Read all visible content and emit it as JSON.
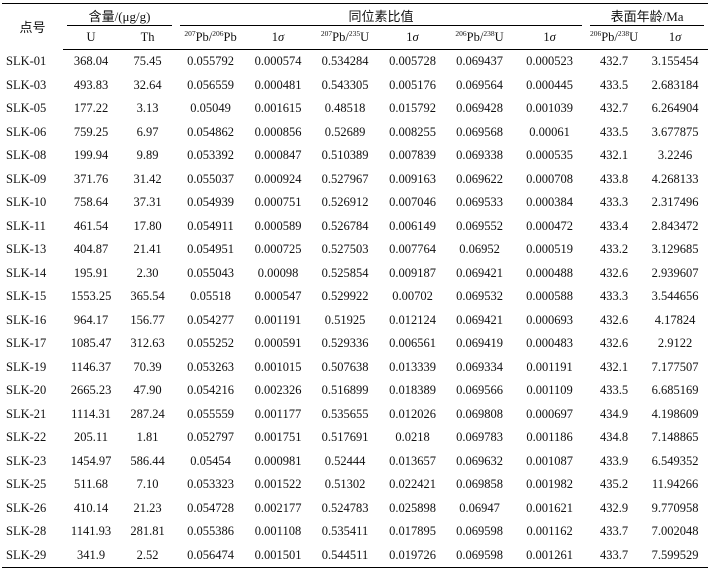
{
  "header": {
    "point_label": "点号",
    "content_label": "含量/(μg/g)",
    "ratio_label": "同位素比值",
    "age_label": "表面年龄/Ma",
    "cols": {
      "u": "U",
      "th": "Th",
      "pb207_pb206_mass_a": "207",
      "pb207_pb206_elem_a": "Pb/",
      "pb207_pb206_mass_b": "206",
      "pb207_pb206_elem_b": "Pb",
      "sigma_one_num": "1",
      "sigma_one_sym": "σ",
      "pb207_u235_mass_a": "207",
      "pb207_u235_elem_a": "Pb/",
      "pb207_u235_mass_b": "235",
      "pb207_u235_elem_b": "U",
      "pb206_u238_mass_a": "206",
      "pb206_u238_elem_a": "Pb/",
      "pb206_u238_mass_b": "238",
      "pb206_u238_elem_b": "U",
      "age_mass_a": "206",
      "age_elem_a": "Pb/",
      "age_mass_b": "238",
      "age_elem_b": "U"
    }
  },
  "rows": [
    [
      "SLK-01",
      "368.04",
      "75.45",
      "0.055792",
      "0.000574",
      "0.534284",
      "0.005728",
      "0.069437",
      "0.000523",
      "432.7",
      "3.155454"
    ],
    [
      "SLK-03",
      "493.83",
      "32.64",
      "0.056559",
      "0.000481",
      "0.543305",
      "0.005176",
      "0.069564",
      "0.000445",
      "433.5",
      "2.683184"
    ],
    [
      "SLK-05",
      "177.22",
      "3.13",
      "0.05049",
      "0.001615",
      "0.48518",
      "0.015792",
      "0.069428",
      "0.001039",
      "432.7",
      "6.264904"
    ],
    [
      "SLK-06",
      "759.25",
      "6.97",
      "0.054862",
      "0.000856",
      "0.52689",
      "0.008255",
      "0.069568",
      "0.00061",
      "433.5",
      "3.677875"
    ],
    [
      "SLK-08",
      "199.94",
      "9.89",
      "0.053392",
      "0.000847",
      "0.510389",
      "0.007839",
      "0.069338",
      "0.000535",
      "432.1",
      "3.2246"
    ],
    [
      "SLK-09",
      "371.76",
      "31.42",
      "0.055037",
      "0.000924",
      "0.527967",
      "0.009163",
      "0.069622",
      "0.000708",
      "433.8",
      "4.268133"
    ],
    [
      "SLK-10",
      "758.64",
      "37.31",
      "0.054939",
      "0.000751",
      "0.526912",
      "0.007046",
      "0.069533",
      "0.000384",
      "433.3",
      "2.317496"
    ],
    [
      "SLK-11",
      "461.54",
      "17.80",
      "0.054911",
      "0.000589",
      "0.526784",
      "0.006149",
      "0.069552",
      "0.000472",
      "433.4",
      "2.843472"
    ],
    [
      "SLK-13",
      "404.87",
      "21.41",
      "0.054951",
      "0.000725",
      "0.527503",
      "0.007764",
      "0.06952",
      "0.000519",
      "433.2",
      "3.129685"
    ],
    [
      "SLK-14",
      "195.91",
      "2.30",
      "0.055043",
      "0.00098",
      "0.525854",
      "0.009187",
      "0.069421",
      "0.000488",
      "432.6",
      "2.939607"
    ],
    [
      "SLK-15",
      "1553.25",
      "365.54",
      "0.05518",
      "0.000547",
      "0.529922",
      "0.00702",
      "0.069532",
      "0.000588",
      "433.3",
      "3.544656"
    ],
    [
      "SLK-16",
      "964.17",
      "156.77",
      "0.054277",
      "0.001191",
      "0.51925",
      "0.012124",
      "0.069421",
      "0.000693",
      "432.6",
      "4.17824"
    ],
    [
      "SLK-17",
      "1085.47",
      "312.63",
      "0.055252",
      "0.000591",
      "0.529336",
      "0.006561",
      "0.069419",
      "0.000483",
      "432.6",
      "2.9122"
    ],
    [
      "SLK-19",
      "1146.37",
      "70.39",
      "0.053263",
      "0.001015",
      "0.507638",
      "0.013339",
      "0.069334",
      "0.001191",
      "432.1",
      "7.177507"
    ],
    [
      "SLK-20",
      "2665.23",
      "47.90",
      "0.054216",
      "0.002326",
      "0.516899",
      "0.018389",
      "0.069566",
      "0.001109",
      "433.5",
      "6.685169"
    ],
    [
      "SLK-21",
      "1114.31",
      "287.24",
      "0.055559",
      "0.001177",
      "0.535655",
      "0.012026",
      "0.069808",
      "0.000697",
      "434.9",
      "4.198609"
    ],
    [
      "SLK-22",
      "205.11",
      "1.81",
      "0.052797",
      "0.001751",
      "0.517691",
      "0.0218",
      "0.069783",
      "0.001186",
      "434.8",
      "7.148865"
    ],
    [
      "SLK-23",
      "1454.97",
      "586.44",
      "0.05454",
      "0.000981",
      "0.52444",
      "0.013657",
      "0.069632",
      "0.001087",
      "433.9",
      "6.549352"
    ],
    [
      "SLK-25",
      "511.68",
      "7.10",
      "0.053323",
      "0.001522",
      "0.51302",
      "0.022421",
      "0.069858",
      "0.001982",
      "435.2",
      "11.94266"
    ],
    [
      "SLK-26",
      "410.14",
      "21.23",
      "0.054728",
      "0.002177",
      "0.524783",
      "0.025898",
      "0.06947",
      "0.001621",
      "432.9",
      "9.770958"
    ],
    [
      "SLK-28",
      "1141.93",
      "281.81",
      "0.055386",
      "0.001108",
      "0.535411",
      "0.017895",
      "0.069598",
      "0.001162",
      "433.7",
      "7.002048"
    ],
    [
      "SLK-29",
      "341.9",
      "2.52",
      "0.056474",
      "0.001501",
      "0.544511",
      "0.019726",
      "0.069598",
      "0.001261",
      "433.7",
      "7.599529"
    ]
  ]
}
